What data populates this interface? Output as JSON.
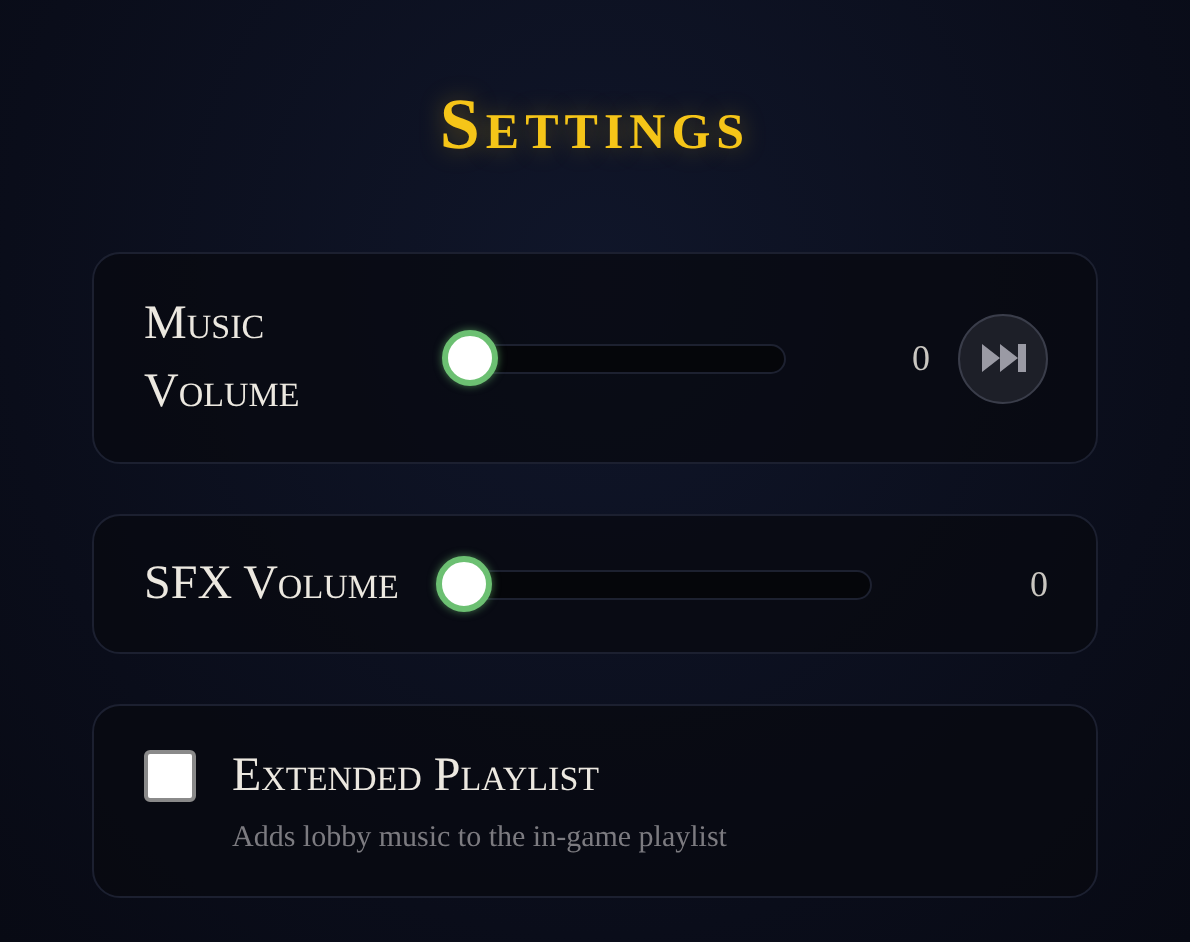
{
  "title": "Settings",
  "sliders": [
    {
      "label": "Music Volume",
      "level": 0,
      "reading": "0",
      "skip_button": true
    },
    {
      "label": "SFX Volume",
      "level": 0,
      "reading": "0",
      "skip_button": false
    }
  ],
  "options": [
    {
      "label": "Extended Playlist",
      "checked": false,
      "description": "Adds lobby music to the in-game playlist"
    }
  ]
}
